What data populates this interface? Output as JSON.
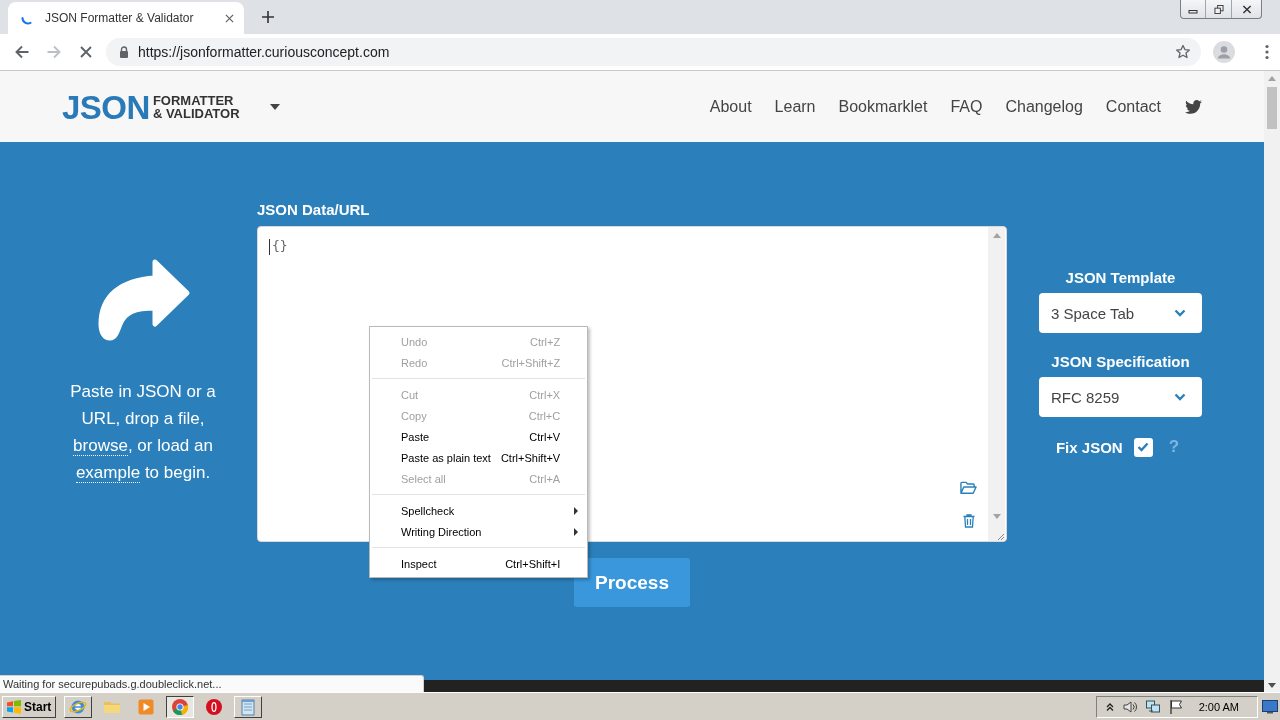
{
  "browser": {
    "tab": {
      "title": "JSON Formatter & Validator",
      "loading": true
    },
    "nav_buttons": [
      {
        "kind": "back",
        "disabled": false
      },
      {
        "kind": "forward",
        "disabled": true
      },
      {
        "kind": "stop",
        "disabled": false
      }
    ],
    "address": "https://jsonformatter.curiousconcept.com"
  },
  "site_header": {
    "logo": {
      "title": "JSON",
      "subtitle_lines": [
        "FORMATTER",
        "& VALIDATOR"
      ]
    },
    "nav": [
      "About",
      "Learn",
      "Bookmarklet",
      "FAQ",
      "Changelog",
      "Contact"
    ]
  },
  "intro": {
    "segments": [
      {
        "kind": "text",
        "text": "Paste in JSON or a URL, drop a file, "
      },
      {
        "kind": "link",
        "text": "browse"
      },
      {
        "kind": "text",
        "text": ", or load an "
      },
      {
        "kind": "link",
        "text": "example"
      },
      {
        "kind": "text",
        "text": " to begin."
      }
    ]
  },
  "editor": {
    "label": "JSON Data/URL",
    "value": "{}"
  },
  "process_button": "Process",
  "options": {
    "template": {
      "label": "JSON Template",
      "value": "3 Space Tab"
    },
    "specification": {
      "label": "JSON Specification",
      "value": "RFC 8259"
    },
    "fix_json": {
      "label": "Fix JSON",
      "checked": true,
      "help": "?"
    }
  },
  "context_menu": {
    "groups": [
      [
        {
          "label": "Undo",
          "shortcut": "Ctrl+Z",
          "disabled": true,
          "submenu": false
        },
        {
          "label": "Redo",
          "shortcut": "Ctrl+Shift+Z",
          "disabled": true,
          "submenu": false
        }
      ],
      [
        {
          "label": "Cut",
          "shortcut": "Ctrl+X",
          "disabled": true,
          "submenu": false
        },
        {
          "label": "Copy",
          "shortcut": "Ctrl+C",
          "disabled": true,
          "submenu": false
        },
        {
          "label": "Paste",
          "shortcut": "Ctrl+V",
          "disabled": false,
          "submenu": false
        },
        {
          "label": "Paste as plain text",
          "shortcut": "Ctrl+Shift+V",
          "disabled": false,
          "submenu": false
        },
        {
          "label": "Select all",
          "shortcut": "Ctrl+A",
          "disabled": true,
          "submenu": false
        }
      ],
      [
        {
          "label": "Spellcheck",
          "disabled": false,
          "submenu": true
        },
        {
          "label": "Writing Direction",
          "disabled": false,
          "submenu": true
        }
      ],
      [
        {
          "label": "Inspect",
          "shortcut": "Ctrl+Shift+I",
          "disabled": false,
          "submenu": false
        }
      ]
    ]
  },
  "status_bubble": "Waiting for securepubads.g.doubleclick.net...",
  "taskbar": {
    "start": "Start",
    "apps": [
      {
        "kind": "globe",
        "open": true,
        "selected": false
      },
      {
        "kind": "folder",
        "open": false,
        "selected": false
      },
      {
        "kind": "player",
        "open": false,
        "selected": false
      },
      {
        "kind": "browser",
        "open": true,
        "selected": true
      },
      {
        "kind": "ring",
        "open": false,
        "selected": false
      },
      {
        "kind": "notepad",
        "open": true,
        "selected": false
      }
    ],
    "clock": "2:00 AM"
  }
}
